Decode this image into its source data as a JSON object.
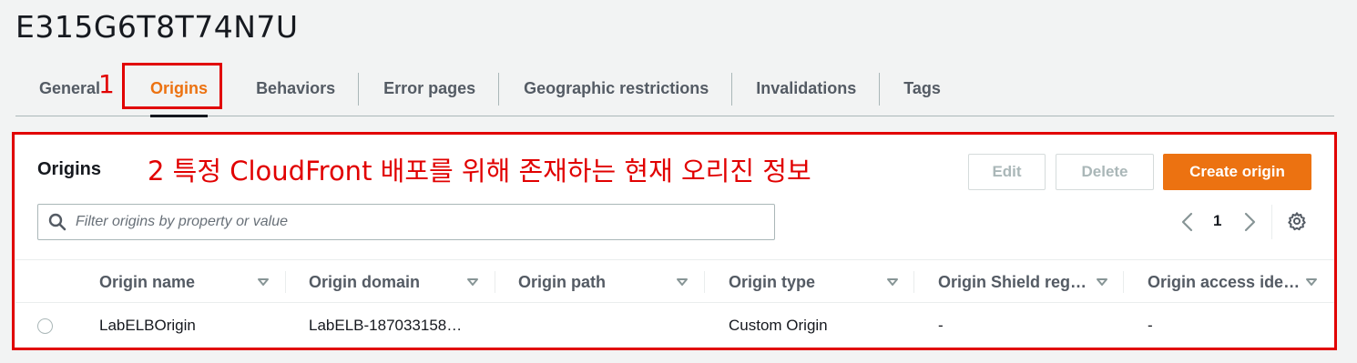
{
  "distribution": {
    "id": "E315G6T8T74N7U"
  },
  "tabs": [
    {
      "label": "General",
      "active": false
    },
    {
      "label": "Origins",
      "active": true
    },
    {
      "label": "Behaviors",
      "active": false
    },
    {
      "label": "Error pages",
      "active": false
    },
    {
      "label": "Geographic restrictions",
      "active": false
    },
    {
      "label": "Invalidations",
      "active": false
    },
    {
      "label": "Tags",
      "active": false
    }
  ],
  "annotations": {
    "num1": "1",
    "caption": "2 특정 CloudFront 배포를 위해 존재하는 현재 오리진 정보",
    "color": "#e10000"
  },
  "origins_panel": {
    "title": "Origins",
    "buttons": {
      "edit": "Edit",
      "delete": "Delete",
      "create": "Create origin"
    },
    "search": {
      "placeholder": "Filter origins by property or value",
      "value": ""
    },
    "pagination": {
      "page": "1"
    },
    "icons": {
      "search": "search-icon",
      "prev": "chevron-left-icon",
      "next": "chevron-right-icon",
      "settings": "gear-icon",
      "sort": "caret-down-icon"
    },
    "columns": [
      "Origin name",
      "Origin domain",
      "Origin path",
      "Origin type",
      "Origin Shield reg…",
      "Origin access ide…"
    ],
    "rows": [
      {
        "name": "LabELBOrigin",
        "domain": "LabELB-187033158…",
        "path": "",
        "type": "Custom Origin",
        "shield_region": "-",
        "access_identity": "-"
      }
    ]
  },
  "colors": {
    "accent": "#ec7211",
    "text": "#16191f",
    "muted": "#545b64",
    "border": "#aab7b8",
    "background": "#f2f3f3"
  }
}
